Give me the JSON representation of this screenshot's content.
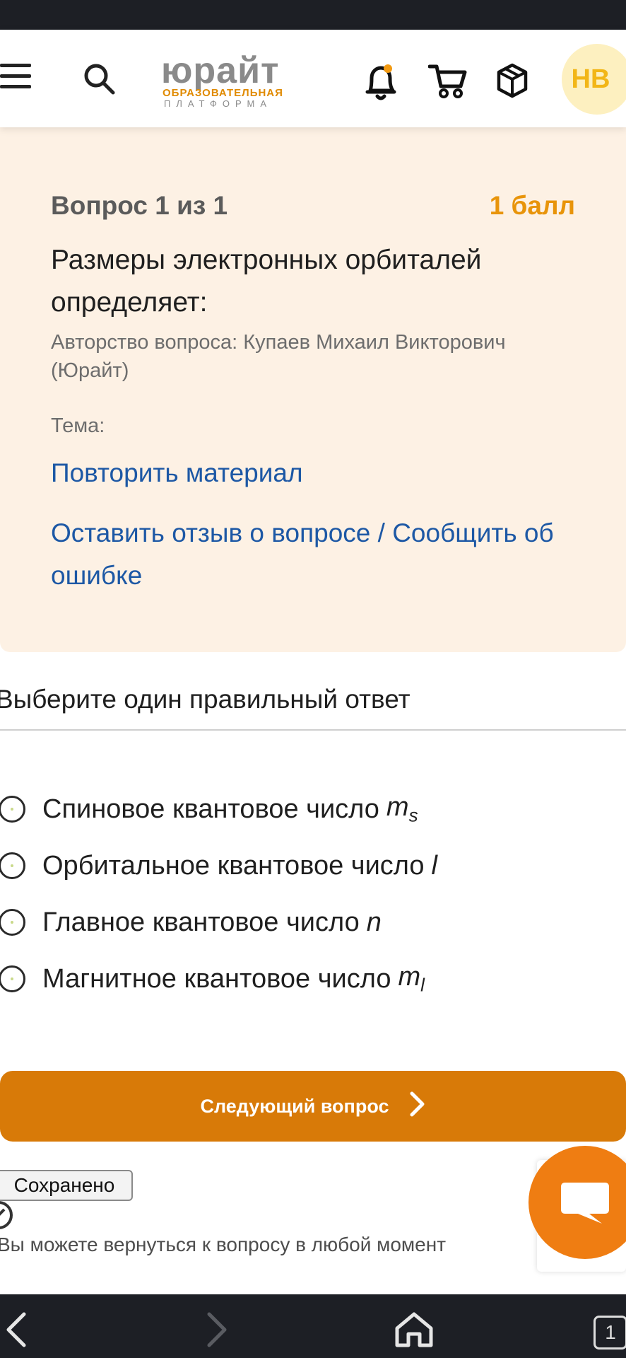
{
  "header": {
    "logo_main": "юрайт",
    "logo_sub": "ОБРАЗОВАТЕЛЬНАЯ",
    "logo_sub2": "ПЛАТФОРМА",
    "avatar_initials": "НВ",
    "icons": [
      "menu-icon",
      "search-icon",
      "bell-icon",
      "cart-icon",
      "box-icon"
    ]
  },
  "question": {
    "number_label": "Вопрос 1 из 1",
    "points_label": "1 балл",
    "text": "Размеры электронных орбиталей определяет:",
    "author": "Авторство вопроса: Купаев Михаил Викторович (Юрайт)",
    "topic_label": "Тема:",
    "repeat_link": "Повторить материал",
    "feedback_link": "Оставить отзыв о вопросе / Сообщить об ошибке"
  },
  "answer": {
    "instruction": "Выберите один правильный ответ",
    "options": [
      {
        "text": "Спиновое квантовое число",
        "symbol": "m",
        "sub": "s"
      },
      {
        "text": "Орбитальное квантовое число",
        "symbol": "l",
        "sub": ""
      },
      {
        "text": "Главное квантовое число",
        "symbol": "n",
        "sub": ""
      },
      {
        "text": "Магнитное квантовое число",
        "symbol": "m",
        "sub": "l"
      }
    ]
  },
  "footer": {
    "next_button": "Следующий вопрос",
    "saved_badge": "Сохранено",
    "return_note": "Вы можете вернуться к вопросу в любой момент"
  },
  "navbar": {
    "tab_count": "1"
  },
  "colors": {
    "accent_orange": "#d87a08",
    "card_bg": "#fdf1e4",
    "link_blue": "#1d58a5",
    "points_orange": "#e8940a"
  }
}
